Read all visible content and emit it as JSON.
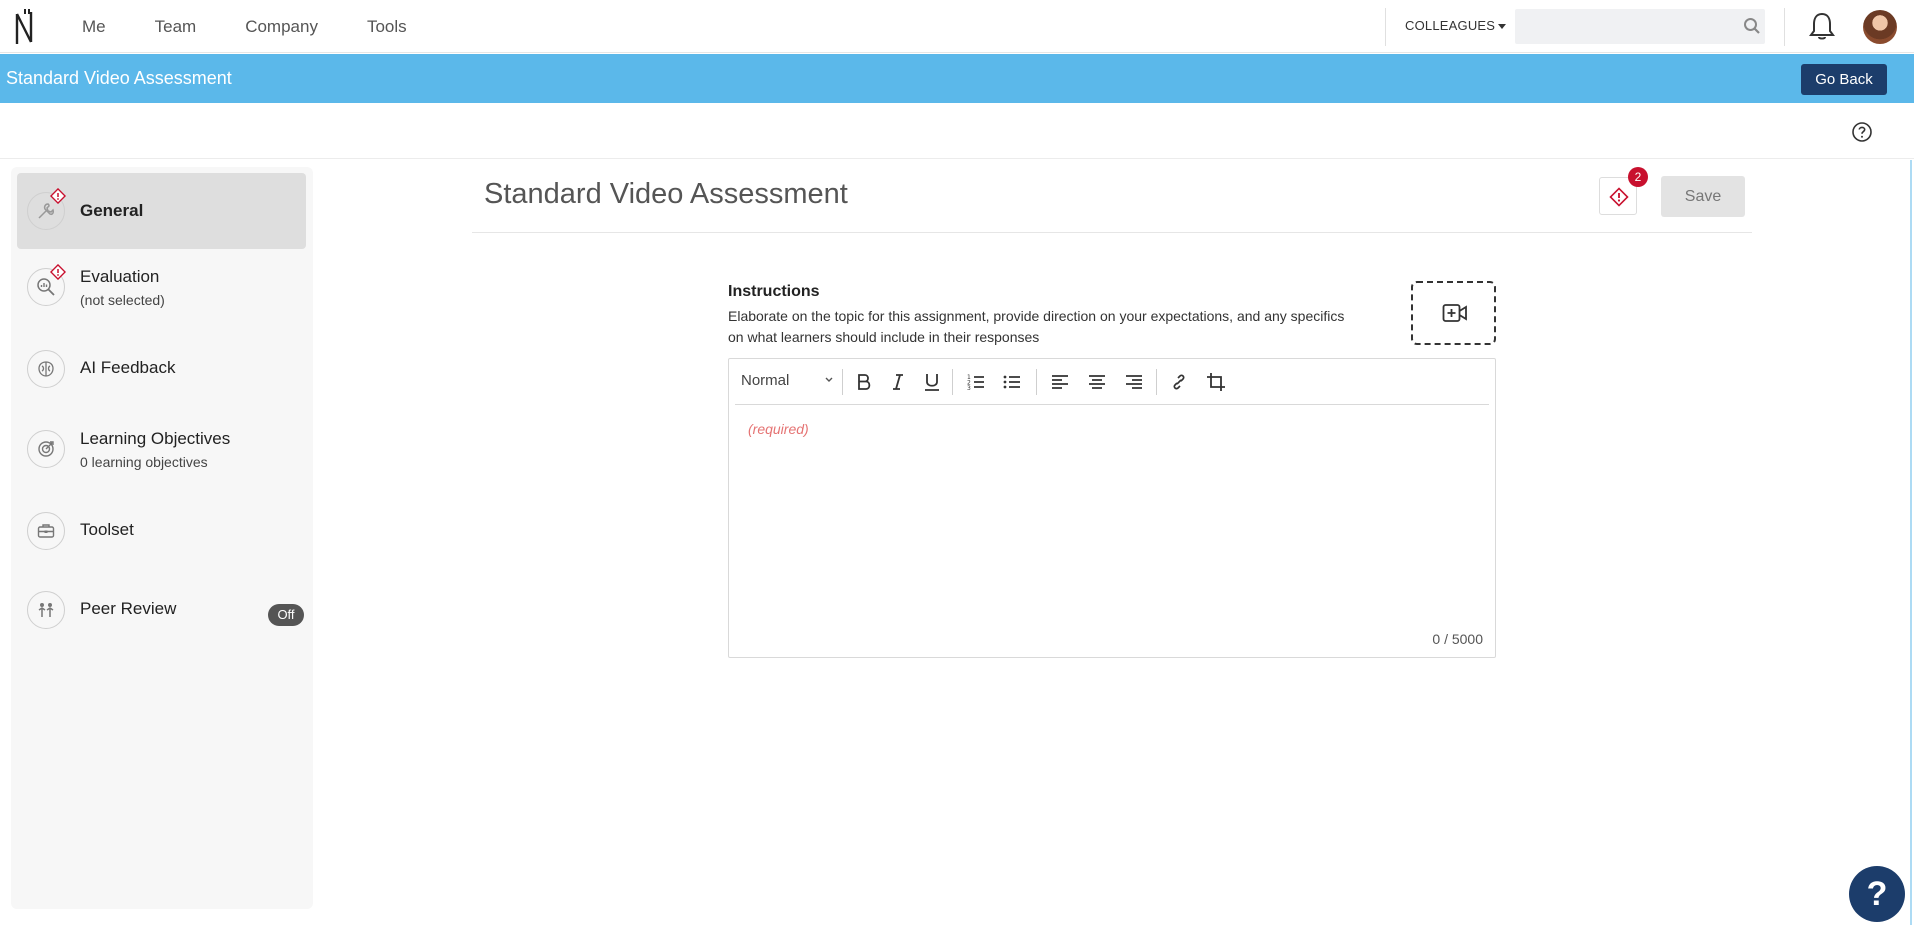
{
  "topnav": {
    "nav_items": [
      "Me",
      "Team",
      "Company",
      "Tools"
    ],
    "colleagues_label": "COLLEAGUES",
    "search": {
      "value": "",
      "placeholder": ""
    },
    "icons": {
      "logo": "brand-logo",
      "search": "search-icon",
      "bell": "bell-icon",
      "avatar": "user-avatar"
    }
  },
  "banner": {
    "title": "Standard Video Assessment",
    "go_back_label": "Go Back",
    "color": "#5bb8ea"
  },
  "sidebar": {
    "items": [
      {
        "label": "General",
        "sub": "",
        "icon": "wrench-icon",
        "warning": true,
        "active": true
      },
      {
        "label": "Evaluation",
        "sub": "(not selected)",
        "icon": "magnify-chart-icon",
        "warning": true,
        "active": false
      },
      {
        "label": "AI Feedback",
        "sub": "",
        "icon": "brain-icon",
        "warning": false,
        "active": false
      },
      {
        "label": "Learning Objectives",
        "sub": "0 learning objectives",
        "icon": "target-icon",
        "warning": false,
        "active": false
      },
      {
        "label": "Toolset",
        "sub": "",
        "icon": "toolbox-icon",
        "warning": false,
        "active": false
      },
      {
        "label": "Peer Review",
        "sub": "",
        "icon": "people-icon",
        "warning": false,
        "active": false,
        "toggle": "Off"
      }
    ]
  },
  "main": {
    "title": "Standard Video Assessment",
    "alert_count": "2",
    "save_label": "Save",
    "instructions": {
      "heading": "Instructions",
      "description": "Elaborate on the topic for this assignment, provide direction on your expectations, and any specifics on what learners should include in their responses",
      "add_video_icon": "video-plus-icon"
    },
    "editor": {
      "format_value": "Normal",
      "placeholder": "(required)",
      "counter": "0 / 5000",
      "tools": [
        "bold-icon",
        "italic-icon",
        "underline-icon",
        "ordered-list-icon",
        "bullet-list-icon",
        "align-left-icon",
        "align-center-icon",
        "align-right-icon",
        "link-icon",
        "crop-icon"
      ]
    }
  },
  "help_fab_label": "?",
  "colors": {
    "accent_dark": "#1c3d6b",
    "warning": "#c8102e"
  }
}
